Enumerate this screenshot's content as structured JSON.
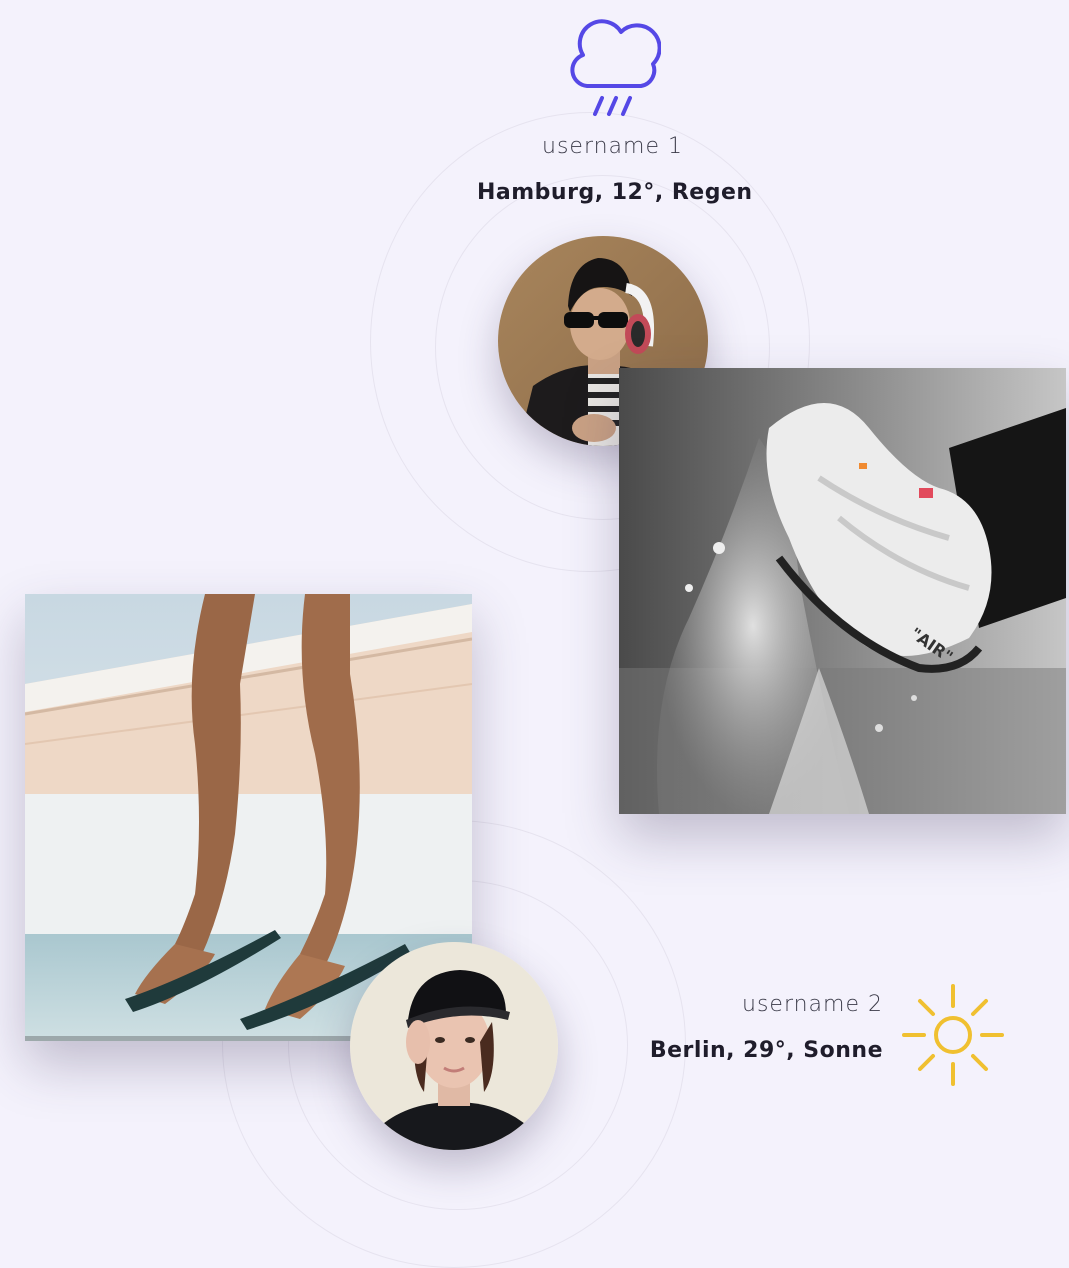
{
  "user1": {
    "username": "username 1",
    "weather_line": "Hamburg, 12°, Regen",
    "weather_icon": "rain-cloud-icon",
    "icon_color": "#5548e6"
  },
  "user2": {
    "username": "username 2",
    "weather_line": "Berlin, 29°, Sonne",
    "weather_icon": "sun-icon",
    "icon_color": "#f0c030"
  },
  "colors": {
    "background": "#f4f2fc",
    "text_dark": "#1f1d2b",
    "text_light": "#3a3a48",
    "ring": "#e6e3ef"
  }
}
